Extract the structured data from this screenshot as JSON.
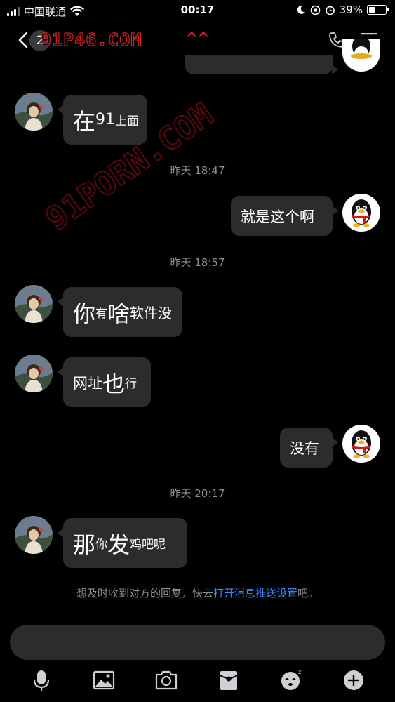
{
  "status_bar": {
    "carrier": "中国联通",
    "time": "00:17",
    "battery": "39%",
    "battery_level": 0.39
  },
  "nav": {
    "unread_count": "2",
    "watermark": "91P46.COM",
    "title": "^^"
  },
  "watermark_diag": "91PORN.COM",
  "messages": {
    "m1": {
      "big": "在",
      "rest1": "91",
      "rest2": "上面"
    },
    "time1": "昨天 18:47",
    "m2": {
      "text": "就是这个啊"
    },
    "time2": "昨天 18:57",
    "m3": {
      "a": "你",
      "b": "有",
      "c": "啥",
      "d": "软件没"
    },
    "m4": {
      "a": "网址",
      "b": "也",
      "c": "行"
    },
    "m5": {
      "text": "没有"
    },
    "time3": "昨天 20:17",
    "m6": {
      "a": "那",
      "b": "你",
      "c": "发",
      "d": "鸡吧呢"
    }
  },
  "push_tip": {
    "prefix": "想及时收到对方的回复，快去",
    "link": "打开消息推送设置",
    "suffix": "吧。"
  },
  "toolbar": {
    "icons": [
      "microphone-icon",
      "image-icon",
      "camera-icon",
      "red-packet-icon",
      "emoji-icon",
      "plus-icon"
    ]
  },
  "colors": {
    "bubble": "#2c2c2e",
    "link": "#3d8af7",
    "title": "#e21d2a",
    "background": "#000000"
  }
}
